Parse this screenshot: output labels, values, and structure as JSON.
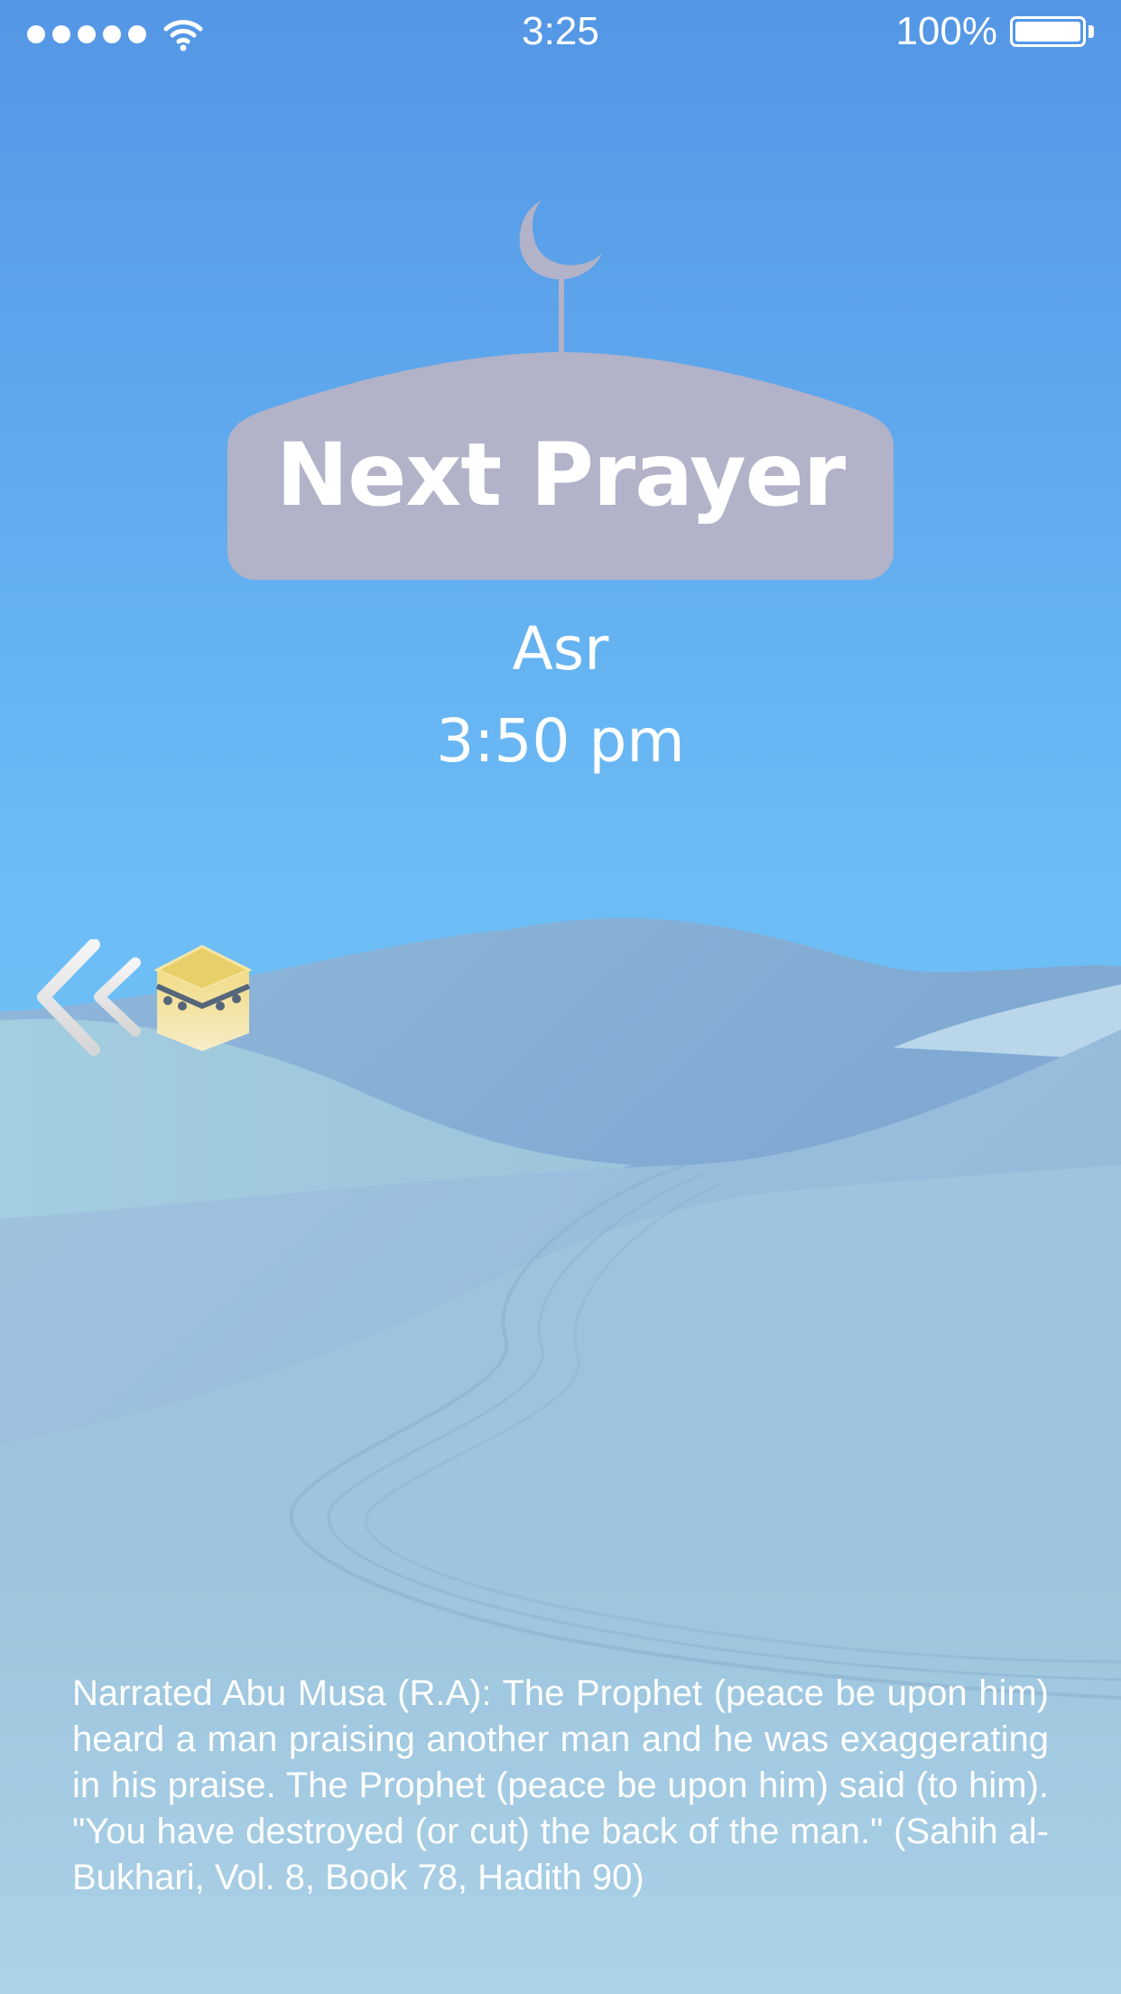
{
  "status_bar": {
    "time": "3:25",
    "battery_percent": "100%",
    "signal_dots": 5,
    "icons": [
      "signal-dots-icon",
      "wifi-icon",
      "battery-icon"
    ]
  },
  "header": {
    "title": "Next Prayer",
    "icon": "mosque-dome-crescent-icon"
  },
  "prayer": {
    "name": "Asr",
    "time": "3:50 pm"
  },
  "nav": {
    "icons": [
      "double-chevron-left-icon",
      "kaaba-icon"
    ]
  },
  "hadith": {
    "text": "Narrated Abu Musa (R.A): The Prophet (peace be upon him) heard a man praising another man and he was exaggerating in his praise. The Prophet (peace be upon him) said (to him). \"You have destroyed (or cut) the back of the man.\" (Sahih al-Bukhari, Vol. 8, Book 78, Hadith 90)"
  },
  "colors": {
    "sky_top": "#5598e6",
    "sky_mid": "#6fc0f6",
    "dune_light": "#a9cde0",
    "dune_shadow": "#86b1d6",
    "dome": "#b2b2c9",
    "kaaba_gold": "#e9cf6a"
  }
}
